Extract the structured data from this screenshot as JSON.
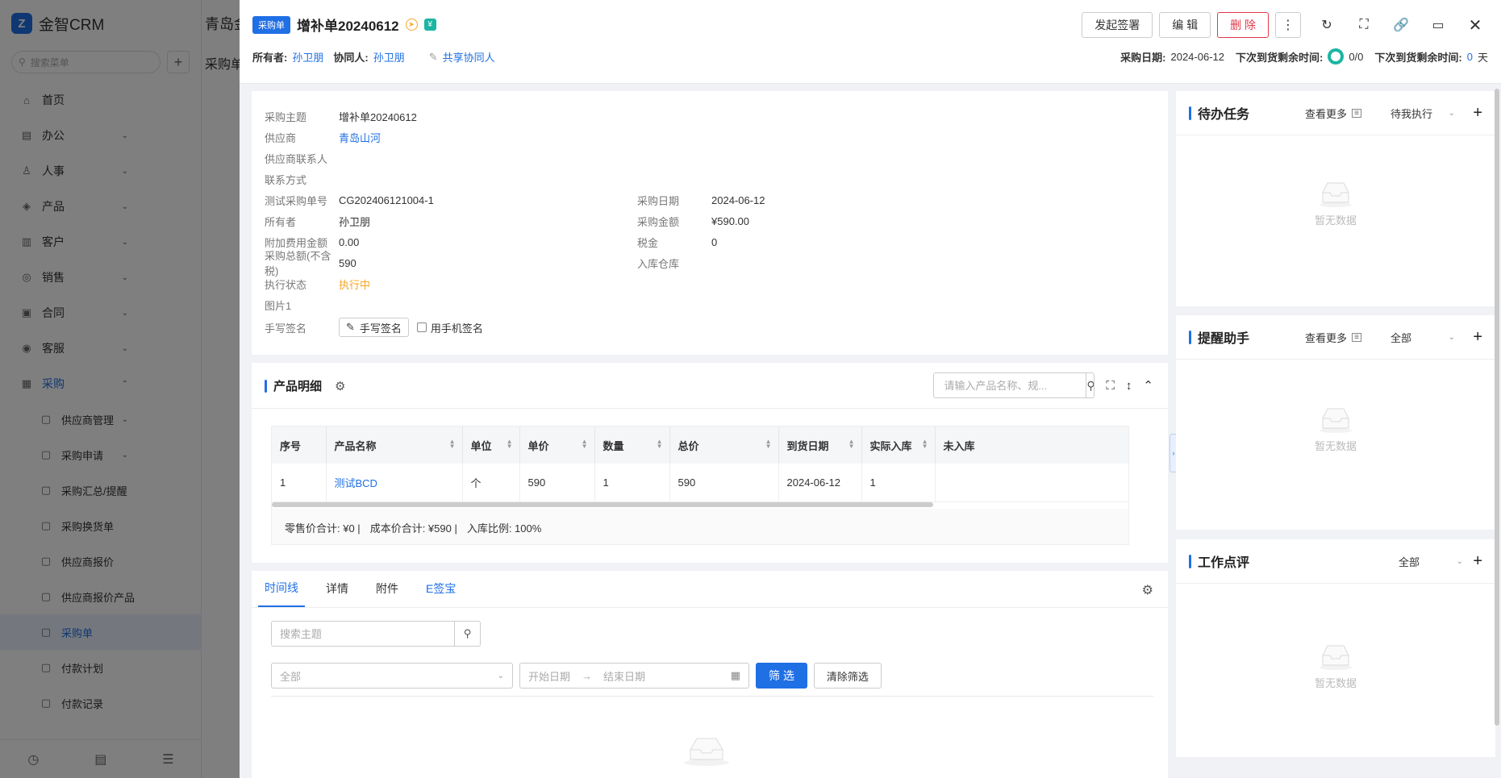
{
  "background": {
    "app_name": "金智CRM",
    "search_placeholder": "搜索菜单",
    "top_title": "青岛金",
    "sub_title": "采购单",
    "nav": [
      {
        "label": "首页",
        "icon": "home-icon",
        "arrow": false
      },
      {
        "label": "办公",
        "icon": "office-icon",
        "arrow": true
      },
      {
        "label": "人事",
        "icon": "people-icon",
        "arrow": true
      },
      {
        "label": "产品",
        "icon": "product-icon",
        "arrow": true
      },
      {
        "label": "客户",
        "icon": "customer-icon",
        "arrow": true
      },
      {
        "label": "销售",
        "icon": "sales-icon",
        "arrow": true
      },
      {
        "label": "合同",
        "icon": "contract-icon",
        "arrow": true
      },
      {
        "label": "客服",
        "icon": "service-icon",
        "arrow": true
      },
      {
        "label": "采购",
        "icon": "purchase-icon",
        "arrow": true,
        "open": true
      },
      {
        "label": "供应商管理",
        "sub": true,
        "arrow": true
      },
      {
        "label": "采购申请",
        "sub": true,
        "arrow": true
      },
      {
        "label": "采购汇总/提醒",
        "sub": true,
        "arrow": true
      },
      {
        "label": "采购换货单",
        "sub": true,
        "arrow": false
      },
      {
        "label": "供应商报价",
        "sub": true,
        "arrow": false
      },
      {
        "label": "供应商报价产品",
        "sub": true,
        "arrow": false
      },
      {
        "label": "采购单",
        "sub": true,
        "arrow": false,
        "active": true
      },
      {
        "label": "付款计划",
        "sub": true,
        "arrow": false
      },
      {
        "label": "付款记录",
        "sub": true,
        "arrow": false
      }
    ]
  },
  "header": {
    "tag": "采购单",
    "title": "增补单20240612",
    "owner_label": "所有者:",
    "owner": "孙卫朋",
    "collab_label": "协同人:",
    "collab": "孙卫朋",
    "share_label": "共享协同人",
    "buttons": {
      "sign": "发起签署",
      "edit": "编 辑",
      "delete": "删 除"
    },
    "purchase_date_label": "采购日期:",
    "purchase_date": "2024-06-12",
    "remaining_label_1": "下次到货剩余时间:",
    "remaining_ratio": "0/0",
    "remaining_label_2": "下次到货剩余时间:",
    "remaining_days": "0",
    "remaining_unit": "天"
  },
  "info": {
    "left": [
      {
        "k": "采购主题",
        "v": "增补单20240612"
      },
      {
        "k": "供应商",
        "v": "青岛山河",
        "style": "link"
      },
      {
        "k": "供应商联系人",
        "v": ""
      },
      {
        "k": "联系方式",
        "v": ""
      },
      {
        "k": "测试采购单号",
        "v": "CG202406121004-1"
      },
      {
        "k": "所有者",
        "v": "孙卫朋"
      },
      {
        "k": "附加费用金额",
        "v": "0.00"
      },
      {
        "k": "采购总额(不含税)",
        "v": "590"
      },
      {
        "k": "执行状态",
        "v": "执行中",
        "style": "orange"
      },
      {
        "k": "图片1",
        "v": ""
      }
    ],
    "right": [
      {
        "k": "采购日期",
        "v": "2024-06-12"
      },
      {
        "k": "采购金额",
        "v": "¥590.00"
      },
      {
        "k": "税金",
        "v": "0"
      },
      {
        "k": "入库仓库",
        "v": ""
      }
    ],
    "signature_label": "手写签名",
    "signature_button": "手写签名",
    "mobile_sign_label": "用手机签名"
  },
  "products": {
    "title": "产品明细",
    "search_placeholder": "请输入产品名称、规...",
    "columns": [
      "序号",
      "产品名称",
      "单位",
      "单价",
      "数量",
      "总价",
      "到货日期",
      "实际入库",
      "未入库"
    ],
    "rows": [
      [
        "1",
        "测试BCD",
        "个",
        "590",
        "1",
        "590",
        "2024-06-12",
        "1",
        ""
      ]
    ],
    "footer": {
      "retail": "零售价合计: ¥0 |",
      "cost": "成本价合计: ¥590 |",
      "ratio": "入库比例: 100%"
    }
  },
  "timeline": {
    "tabs": [
      "时间线",
      "详情",
      "附件",
      "E签宝"
    ],
    "search_placeholder": "搜索主题",
    "select_placeholder": "全部",
    "start_placeholder": "开始日期",
    "end_placeholder": "结束日期",
    "filter_button": "筛 选",
    "clear_button": "清除筛选"
  },
  "right": {
    "tasks": {
      "title": "待办任务",
      "more": "查看更多",
      "filter": "待我执行",
      "empty": "暂无数据"
    },
    "reminder": {
      "title": "提醒助手",
      "more": "查看更多",
      "filter": "全部",
      "empty": "暂无数据"
    },
    "review": {
      "title": "工作点评",
      "filter": "全部",
      "empty": "暂无数据"
    }
  }
}
